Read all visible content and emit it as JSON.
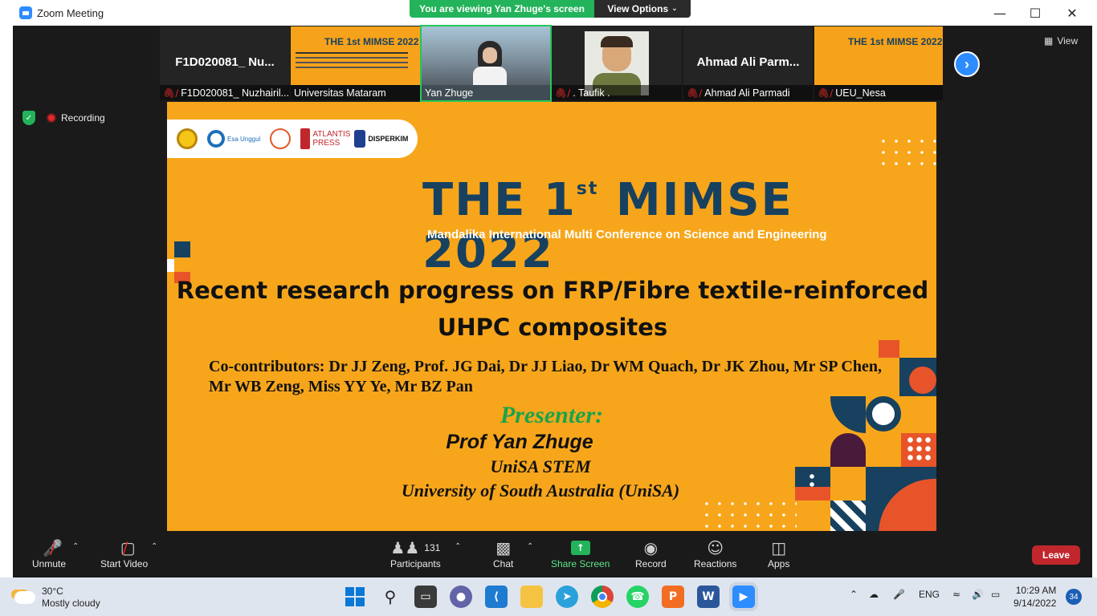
{
  "window": {
    "title": "Zoom Meeting"
  },
  "share_banner": {
    "text": "You are viewing Yan Zhuge's screen",
    "view_options": "View Options"
  },
  "participants_strip": [
    {
      "big_name": "F1D020081_ Nu...",
      "label": "F1D020081_ Nuzhairil...",
      "muted": true
    },
    {
      "label": "Universitas Mataram",
      "muted": false,
      "mini_title": "THE 1st MIMSE 2022"
    },
    {
      "label": "Yan Zhuge",
      "muted": false,
      "active": true
    },
    {
      "label": ". Taufik .",
      "muted": true
    },
    {
      "big_name": "Ahmad Ali Parm...",
      "label": "Ahmad Ali Parmadi",
      "muted": true
    },
    {
      "label": "UEU_Nesa",
      "muted": true,
      "mini_title": "THE 1st MIMSE 2022"
    }
  ],
  "view_button": "View",
  "recording": {
    "label": "Recording"
  },
  "slide": {
    "logos": [
      "Esa Unggul",
      "MANDALIKA",
      "ATLANTIS PRESS",
      "DISPERKIM"
    ],
    "title_main": "THE 1",
    "title_sup": "st",
    "title_rest": " MIMSE 2022",
    "subtitle": "Mandalika International Multi Conference on Science and Engineering",
    "research_title": "Recent research progress on FRP/Fibre textile-reinforced UHPC composites",
    "contributors": "Co-contributors: Dr JJ Zeng, Prof. JG Dai, Dr JJ Liao, Dr WM Quach, Dr JK Zhou, Mr SP Chen, Mr WB Zeng, Miss YY Ye, Mr BZ Pan",
    "presenter_label": "Presenter:",
    "presenter_name": "Prof Yan Zhuge",
    "presenter_unit": "UniSA STEM",
    "presenter_org": "University of South Australia (UniSA)"
  },
  "toolbar": {
    "unmute": "Unmute",
    "start_video": "Start Video",
    "participants": "Participants",
    "participants_count": "131",
    "chat": "Chat",
    "share_screen": "Share Screen",
    "record": "Record",
    "reactions": "Reactions",
    "apps": "Apps",
    "leave": "Leave"
  },
  "taskbar": {
    "weather_temp": "30°C",
    "weather_desc": "Mostly cloudy",
    "language": "ENG",
    "time": "10:29 AM",
    "date": "9/14/2022",
    "notifications": "34"
  }
}
